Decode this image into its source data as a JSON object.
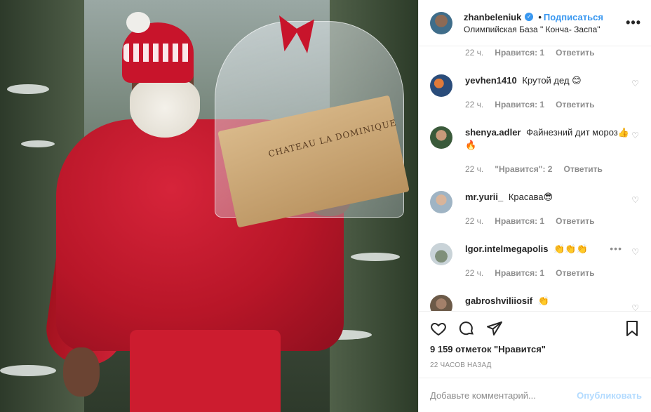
{
  "header": {
    "username": "zhanbeleniuk",
    "separator": "•",
    "follow_label": "Подписаться",
    "location": "Олимпийская База \" Конча- Заспа\"",
    "more_label": "•••"
  },
  "photo": {
    "crate_label": "CHATEAU LA DOMINIQUE"
  },
  "comments": {
    "top_meta": {
      "time": "22 ч.",
      "likes": "Нравится: 1",
      "reply": "Ответить"
    },
    "items": [
      {
        "user": "yevhen1410",
        "text": "Крутой дед 😊",
        "time": "22 ч.",
        "likes": "Нравится: 1",
        "reply": "Ответить"
      },
      {
        "user": "shenya.adler",
        "text": "Файнезний дит мороз👍🔥",
        "time": "22 ч.",
        "likes": "\"Нравится\": 2",
        "reply": "Ответить"
      },
      {
        "user": "mr.yurii_",
        "text": "Красава😎",
        "time": "22 ч.",
        "likes": "Нравится: 1",
        "reply": "Ответить"
      },
      {
        "user": "lgor.intelmegapolis",
        "text": "👏👏👏",
        "time": "22 ч.",
        "likes": "Нравится: 1",
        "reply": "Ответить"
      },
      {
        "user": "gabroshviliiosif",
        "text": "👏",
        "time": "",
        "likes": "",
        "reply": ""
      }
    ]
  },
  "actions": {
    "likes_text": "9 159 отметок \"Нравится\"",
    "posted_time": "22 ЧАСОВ НАЗАД",
    "comment_placeholder": "Добавьте комментарий...",
    "publish_label": "Опубликовать"
  },
  "colors": {
    "link": "#3897f0",
    "muted": "#8e8e8e",
    "publish_disabled": "#b3dbff"
  },
  "icons": [
    "heart-icon",
    "comment-icon",
    "share-icon",
    "bookmark-icon",
    "verified-icon",
    "more-icon"
  ]
}
